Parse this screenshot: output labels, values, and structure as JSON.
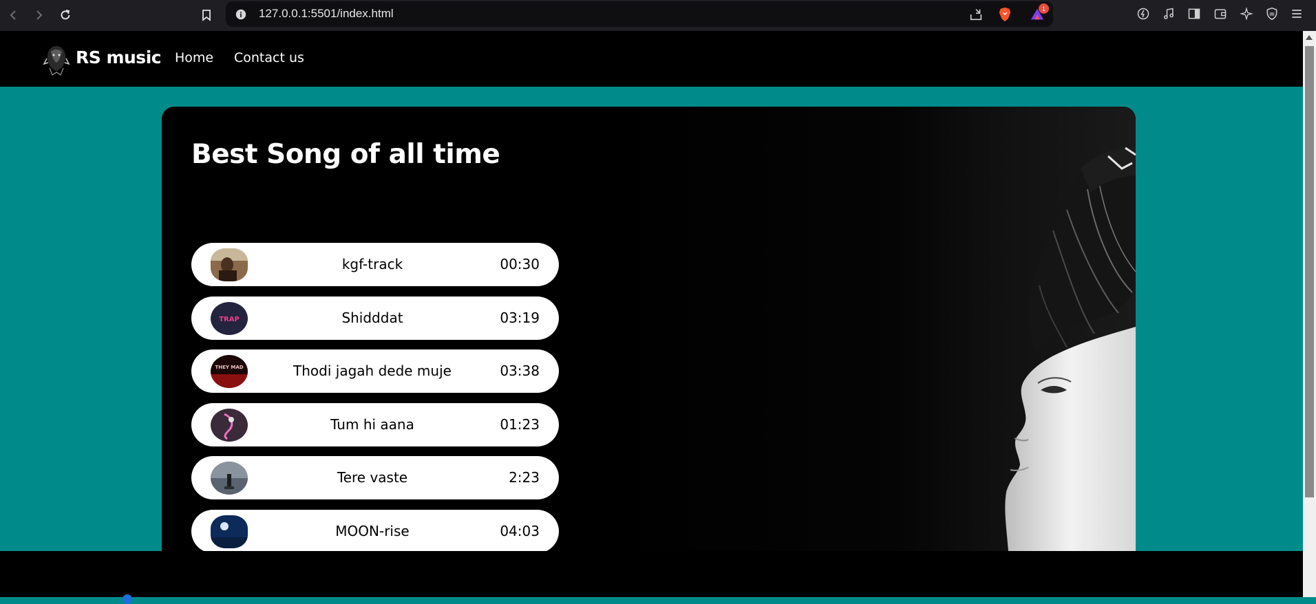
{
  "browser": {
    "url": "127.0.0.1:5501/index.html",
    "extension_badge": "1"
  },
  "site": {
    "brand": "RS music",
    "nav": [
      {
        "label": "Home"
      },
      {
        "label": "Contact us"
      }
    ]
  },
  "main": {
    "title": "Best Song of all time",
    "songs": [
      {
        "name": "kgf-track",
        "duration": "00:30"
      },
      {
        "name": "Shidddat",
        "duration": "03:19"
      },
      {
        "name": "Thodi jagah dede muje",
        "duration": "03:38"
      },
      {
        "name": "Tum hi aana",
        "duration": "01:23"
      },
      {
        "name": "Tere vaste",
        "duration": "2:23"
      },
      {
        "name": "MOON-rise",
        "duration": "04:03"
      }
    ]
  },
  "colors": {
    "page_background": "#008b8b",
    "card_background": "#000000",
    "song_item_background": "#ffffff"
  }
}
